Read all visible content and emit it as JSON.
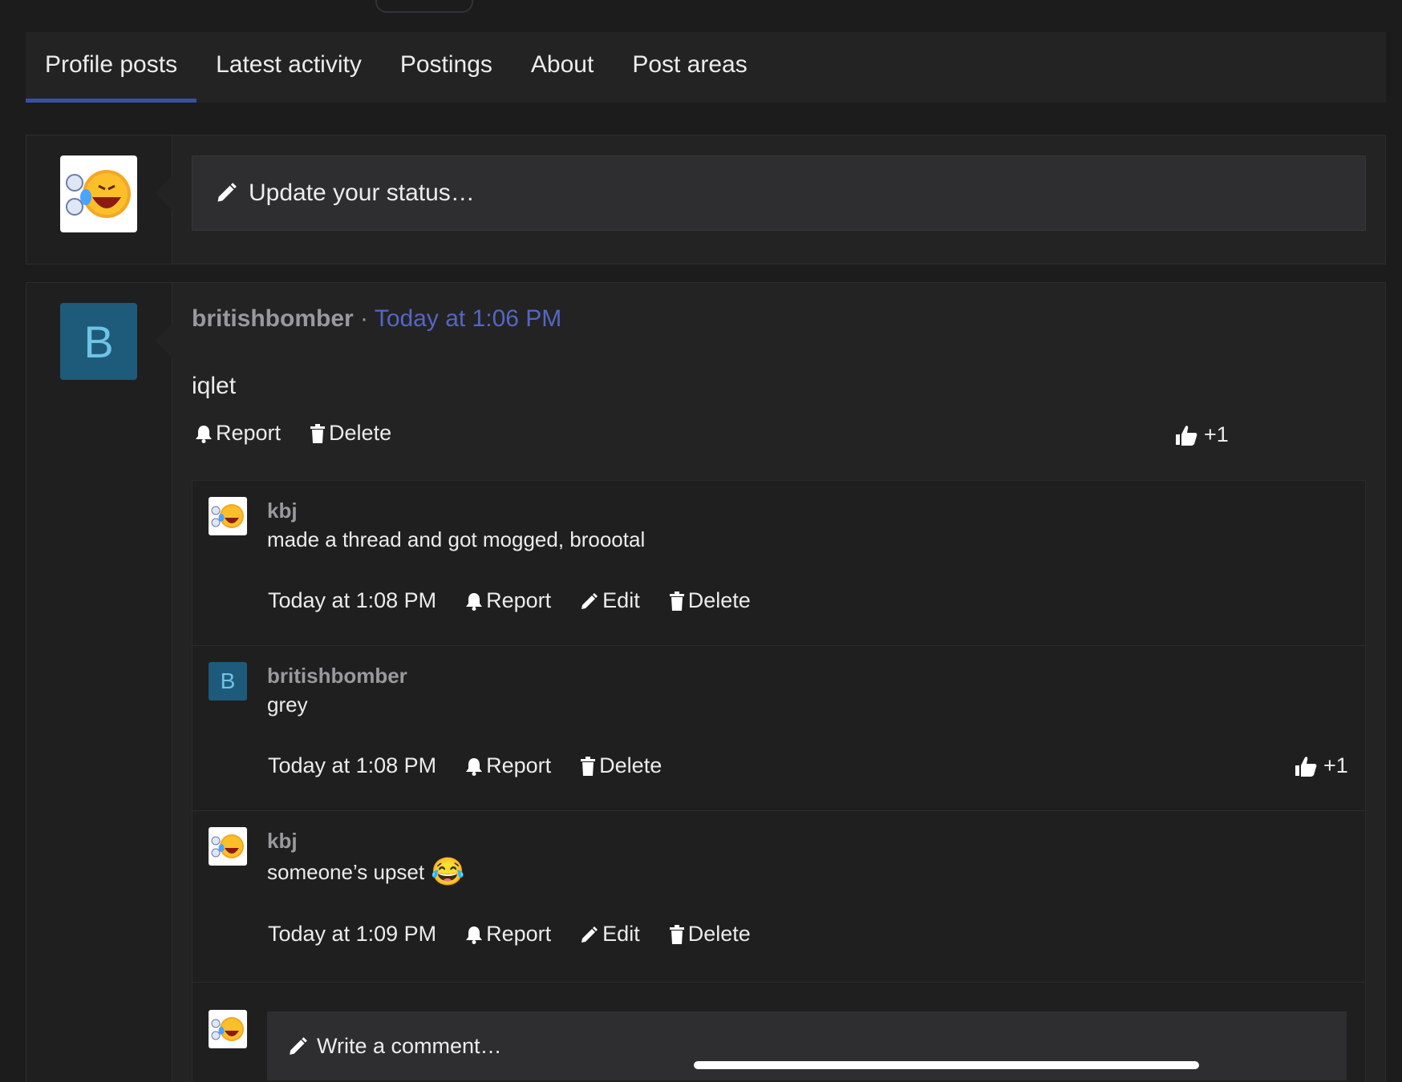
{
  "tabs": [
    {
      "label": "Profile posts",
      "active": true
    },
    {
      "label": "Latest activity",
      "active": false
    },
    {
      "label": "Postings",
      "active": false
    },
    {
      "label": "About",
      "active": false
    },
    {
      "label": "Post areas",
      "active": false
    }
  ],
  "status": {
    "placeholder": "Update your status…",
    "avatar_icon": "crying-laughing-emoji-icon"
  },
  "post": {
    "avatar_letter": "B",
    "user": "britishbomber",
    "separator": " · ",
    "time": "Today at 1:06 PM",
    "body": "iqlet",
    "actions": {
      "report": "Report",
      "delete": "Delete"
    },
    "likes": "+1"
  },
  "comments": [
    {
      "user": "kbj",
      "avatar_icon": "crying-laughing-emoji-icon",
      "text": "made a thread and got mogged, broootal",
      "time": "Today at 1:08 PM",
      "report": "Report",
      "edit": "Edit",
      "delete": "Delete"
    },
    {
      "user": "britishbomber",
      "avatar_letter": "B",
      "text": "grey",
      "time": "Today at 1:08 PM",
      "report": "Report",
      "delete": "Delete",
      "likes": "+1"
    },
    {
      "user": "kbj",
      "avatar_icon": "crying-laughing-emoji-icon",
      "text": "someone’s upset",
      "emoji": "😂",
      "time": "Today at 1:09 PM",
      "report": "Report",
      "edit": "Edit",
      "delete": "Delete"
    }
  ],
  "comment_form": {
    "placeholder": "Write a comment…"
  },
  "colors": {
    "background": "#1c1c1d",
    "panel": "#232324",
    "accent": "#3b4ea3",
    "link": "#5566c2",
    "avatar_letter_bg": "#1e5a7a"
  }
}
